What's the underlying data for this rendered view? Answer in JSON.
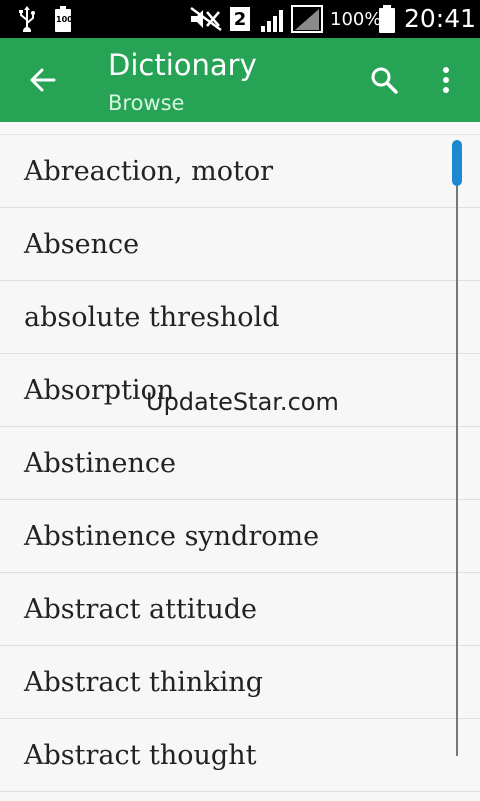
{
  "status_bar": {
    "sim_slot": "2",
    "battery_percent": "100%",
    "time": "20:41",
    "battery_small_label": "100",
    "icons": [
      "usb-icon",
      "battery-saver-icon",
      "mute-icon",
      "sim-icon",
      "signal-icon",
      "signal-empty-icon",
      "battery-icon"
    ]
  },
  "app_bar": {
    "title": "Dictionary",
    "subtitle": "Browse",
    "icons": [
      "back-arrow-icon",
      "search-icon",
      "more-vert-icon"
    ],
    "color": "#27a356"
  },
  "list": {
    "items": [
      "Abreaction, motor",
      "Absence",
      "absolute threshold",
      "Absorption",
      "Abstinence",
      "Abstinence syndrome",
      "Abstract attitude",
      "Abstract thinking",
      "Abstract thought"
    ]
  },
  "scrollbar": {
    "thumb_color": "#1e88d2"
  },
  "watermark": "UpdateStar.com"
}
